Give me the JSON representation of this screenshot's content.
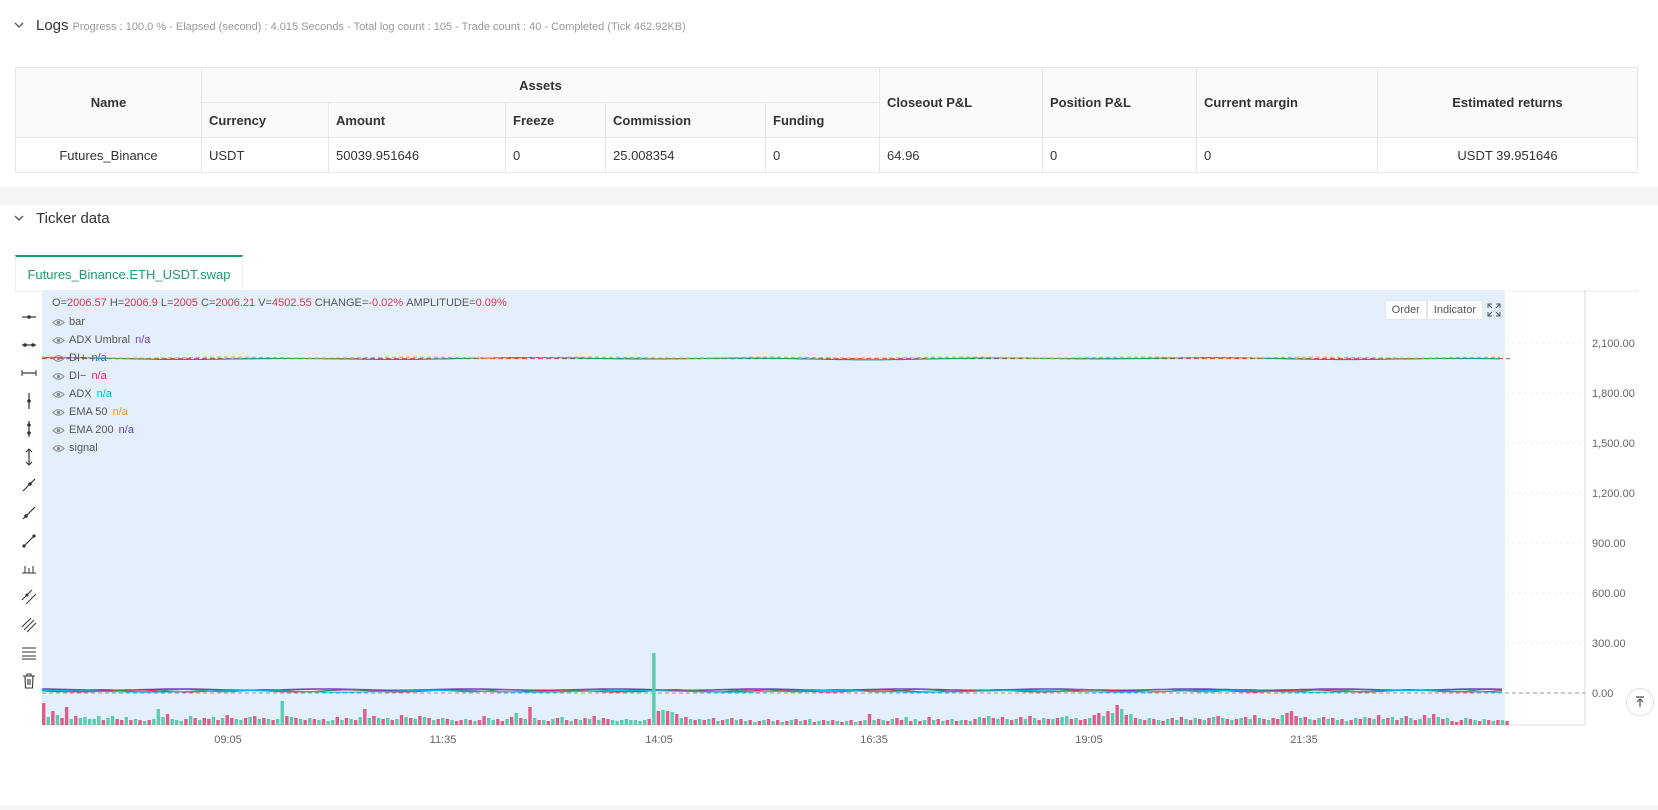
{
  "logs": {
    "title": "Logs",
    "status": "Progress : 100.0 % - Elapsed (second) : 4.015  Seconds - Total log count : 105 - Trade count : 40 - Completed (Tick 462.92KB)"
  },
  "assets_table": {
    "headers": {
      "name": "Name",
      "assets": "Assets",
      "currency": "Currency",
      "amount": "Amount",
      "freeze": "Freeze",
      "commission": "Commission",
      "funding": "Funding",
      "closeout_pnl": "Closeout P&L",
      "position_pnl": "Position P&L",
      "current_margin": "Current margin",
      "estimated_returns": "Estimated returns"
    },
    "row": {
      "name": "Futures_Binance",
      "currency": "USDT",
      "amount": "50039.951646",
      "freeze": "0",
      "commission": "25.008354",
      "funding": "0",
      "closeout_pnl": "64.96",
      "position_pnl": "0",
      "current_margin": "0",
      "estimated_returns": "USDT 39.951646"
    }
  },
  "ticker": {
    "title": "Ticker data",
    "tab_label": "Futures_Binance.ETH_USDT.swap",
    "buttons": {
      "order": "Order",
      "indicator": "Indicator"
    },
    "ohlc": {
      "o_label": "O=",
      "o": "2006.57",
      "h_label": "H=",
      "h": "2006.9",
      "l_label": "L=",
      "l": "2005",
      "c_label": "C=",
      "c": "2006.21",
      "v_label": "V=",
      "v": "4502.55",
      "change_label": "CHANGE=",
      "change": "-0.02%",
      "amp_label": "AMPLITUDE=",
      "amp": "0.09%"
    },
    "legend": [
      {
        "label": "bar",
        "value": "",
        "color": "#555555"
      },
      {
        "label": "ADX Umbral",
        "value": "n/a",
        "color": "#7b3fbf"
      },
      {
        "label": "DI+",
        "value": "n/a",
        "color": "#2962ff"
      },
      {
        "label": "DI−",
        "value": "n/a",
        "color": "#e91e63"
      },
      {
        "label": "ADX",
        "value": "n/a",
        "color": "#00bcd4"
      },
      {
        "label": "EMA 50",
        "value": "n/a",
        "color": "#ff9800"
      },
      {
        "label": "EMA 200",
        "value": "n/a",
        "color": "#673ab7"
      },
      {
        "label": "signal",
        "value": "",
        "color": "#555555"
      }
    ]
  },
  "chart_data": {
    "type": "line",
    "x_ticks": [
      "09:05",
      "11:35",
      "14:05",
      "16:35",
      "19:05",
      "21:35"
    ],
    "y_ticks": [
      "2,100.00",
      "1,800.00",
      "1,500.00",
      "1,200.00",
      "900.00",
      "600.00",
      "300.00",
      "0.00"
    ],
    "ylim": [
      -100,
      2400
    ],
    "price_level": 2006.21,
    "volume_bars": [
      22,
      8,
      14,
      10,
      7,
      18,
      6,
      9,
      7,
      8,
      6,
      6,
      9,
      5,
      7,
      9,
      6,
      5,
      8,
      5,
      6,
      5,
      4,
      5,
      6,
      16,
      8,
      11,
      6,
      5,
      4,
      6,
      9,
      7,
      5,
      7,
      6,
      8,
      5,
      7,
      10,
      7,
      6,
      5,
      7,
      8,
      9,
      6,
      7,
      6,
      5,
      6,
      24,
      9,
      8,
      7,
      6,
      5,
      7,
      6,
      5,
      6,
      4,
      5,
      8,
      5,
      7,
      6,
      5,
      8,
      16,
      7,
      9,
      7,
      6,
      7,
      5,
      6,
      10,
      8,
      7,
      6,
      9,
      8,
      7,
      5,
      6,
      7,
      6,
      5,
      4,
      5,
      6,
      5,
      4,
      5,
      9,
      7,
      5,
      6,
      4,
      6,
      8,
      12,
      7,
      6,
      18,
      7,
      5,
      5,
      4,
      6,
      7,
      8,
      5,
      4,
      6,
      5,
      7,
      6,
      9,
      5,
      7,
      6,
      5,
      4,
      5,
      6,
      5,
      5,
      4,
      5,
      6,
      72,
      14,
      15,
      14,
      13,
      11,
      7,
      8,
      6,
      5,
      6,
      5,
      6,
      7,
      4,
      5,
      6,
      7,
      5,
      6,
      4,
      5,
      3,
      4,
      5,
      6,
      4,
      5,
      3,
      4,
      5,
      6,
      4,
      5,
      6,
      3,
      4,
      5,
      4,
      5,
      4,
      3,
      4,
      5,
      3,
      4,
      5,
      11,
      5,
      6,
      5,
      4,
      6,
      7,
      5,
      8,
      4,
      6,
      4,
      5,
      8,
      5,
      6,
      4,
      5,
      6,
      4,
      5,
      5,
      4,
      6,
      8,
      7,
      9,
      7,
      6,
      8,
      6,
      5,
      6,
      8,
      6,
      9,
      7,
      5,
      7,
      6,
      6,
      7,
      8,
      9,
      6,
      7,
      5,
      6,
      7,
      10,
      12,
      9,
      14,
      12,
      20,
      16,
      10,
      11,
      7,
      6,
      5,
      7,
      6,
      5,
      4,
      6,
      7,
      5,
      8,
      6,
      5,
      7,
      6,
      5,
      7,
      8,
      9,
      7,
      6,
      5,
      6,
      7,
      8,
      6,
      10,
      7,
      6,
      5,
      7,
      6,
      10,
      12,
      14,
      9,
      7,
      8,
      6,
      5,
      7,
      8,
      6,
      7,
      5,
      6,
      4,
      5,
      7,
      6,
      8,
      7,
      6,
      10,
      6,
      7,
      8,
      5,
      7,
      9,
      7,
      5,
      6,
      10,
      7,
      11,
      8,
      6,
      7,
      4,
      3,
      5,
      7,
      6,
      5,
      4,
      6,
      5,
      4,
      5,
      5,
      4
    ],
    "volume_colors_up": [
      false,
      true,
      false,
      true,
      false,
      false,
      true,
      false,
      true,
      true,
      true,
      true,
      true,
      false,
      true,
      true,
      false,
      false,
      true,
      false,
      true,
      false,
      true,
      false,
      true,
      true,
      true,
      false,
      true,
      true,
      true,
      false,
      true,
      false,
      true,
      false,
      false,
      true,
      false,
      true,
      false,
      false,
      true,
      true,
      false,
      true,
      false,
      true,
      false,
      true,
      false,
      true,
      true,
      false,
      true,
      false,
      true,
      false,
      true,
      false,
      true,
      false,
      true,
      true,
      false,
      true,
      false,
      true,
      false,
      true,
      false,
      true,
      false,
      true,
      false,
      true,
      false,
      true,
      false,
      true,
      false,
      true,
      false,
      true,
      false,
      true,
      false,
      true,
      false,
      true,
      false,
      false,
      true,
      false,
      true,
      false,
      false,
      true,
      true,
      false,
      false,
      true,
      false,
      true,
      false,
      true,
      false,
      true,
      false,
      true,
      false,
      true,
      false,
      true,
      false,
      true,
      false,
      true,
      false,
      true,
      false,
      true,
      false,
      false,
      true,
      true,
      true,
      true,
      true,
      true,
      true,
      true,
      false,
      true,
      false,
      true,
      false,
      true,
      false,
      true,
      false,
      true,
      false,
      true,
      false,
      true,
      false,
      true,
      false,
      true,
      false,
      true,
      false,
      true,
      false,
      true,
      false,
      true,
      false,
      true,
      false,
      true,
      false,
      true,
      false,
      true,
      false,
      true,
      false,
      true,
      false,
      true,
      false,
      true,
      false,
      true,
      false,
      true,
      false,
      true,
      false,
      true,
      false,
      true,
      false,
      true,
      false,
      false,
      true,
      false,
      true,
      false,
      true,
      false,
      true,
      false,
      true,
      false,
      true,
      false,
      true,
      false,
      true,
      false,
      true,
      false,
      true,
      false,
      true,
      false,
      true,
      false,
      true,
      false,
      true,
      false,
      true,
      false,
      true,
      false,
      true,
      false,
      true,
      true,
      false,
      true,
      false,
      false,
      true,
      false,
      false,
      true,
      false,
      true,
      false,
      true,
      false,
      true,
      false,
      true,
      false,
      true,
      false,
      true,
      false,
      true,
      false,
      true,
      false,
      true,
      false,
      true,
      false,
      true,
      false,
      true,
      false,
      true,
      false,
      true,
      false,
      true,
      false,
      true,
      false,
      true,
      false,
      true,
      false,
      false,
      true,
      false,
      false,
      false,
      true,
      false,
      true,
      false,
      true,
      false,
      true,
      false,
      true,
      false,
      true,
      false,
      true,
      false,
      true,
      false,
      true,
      false,
      true,
      false,
      true,
      false,
      true,
      false,
      true,
      false,
      true,
      false,
      true,
      false,
      true,
      false,
      true,
      false,
      false,
      false,
      true,
      false,
      true,
      false,
      true,
      false,
      true,
      false,
      true,
      false,
      true,
      false,
      true,
      false,
      true,
      false
    ],
    "colors": {
      "up": "#5ccbb0",
      "down": "#e05c8a",
      "area": "#e3f0fb",
      "grid": "#e9edf2"
    }
  }
}
